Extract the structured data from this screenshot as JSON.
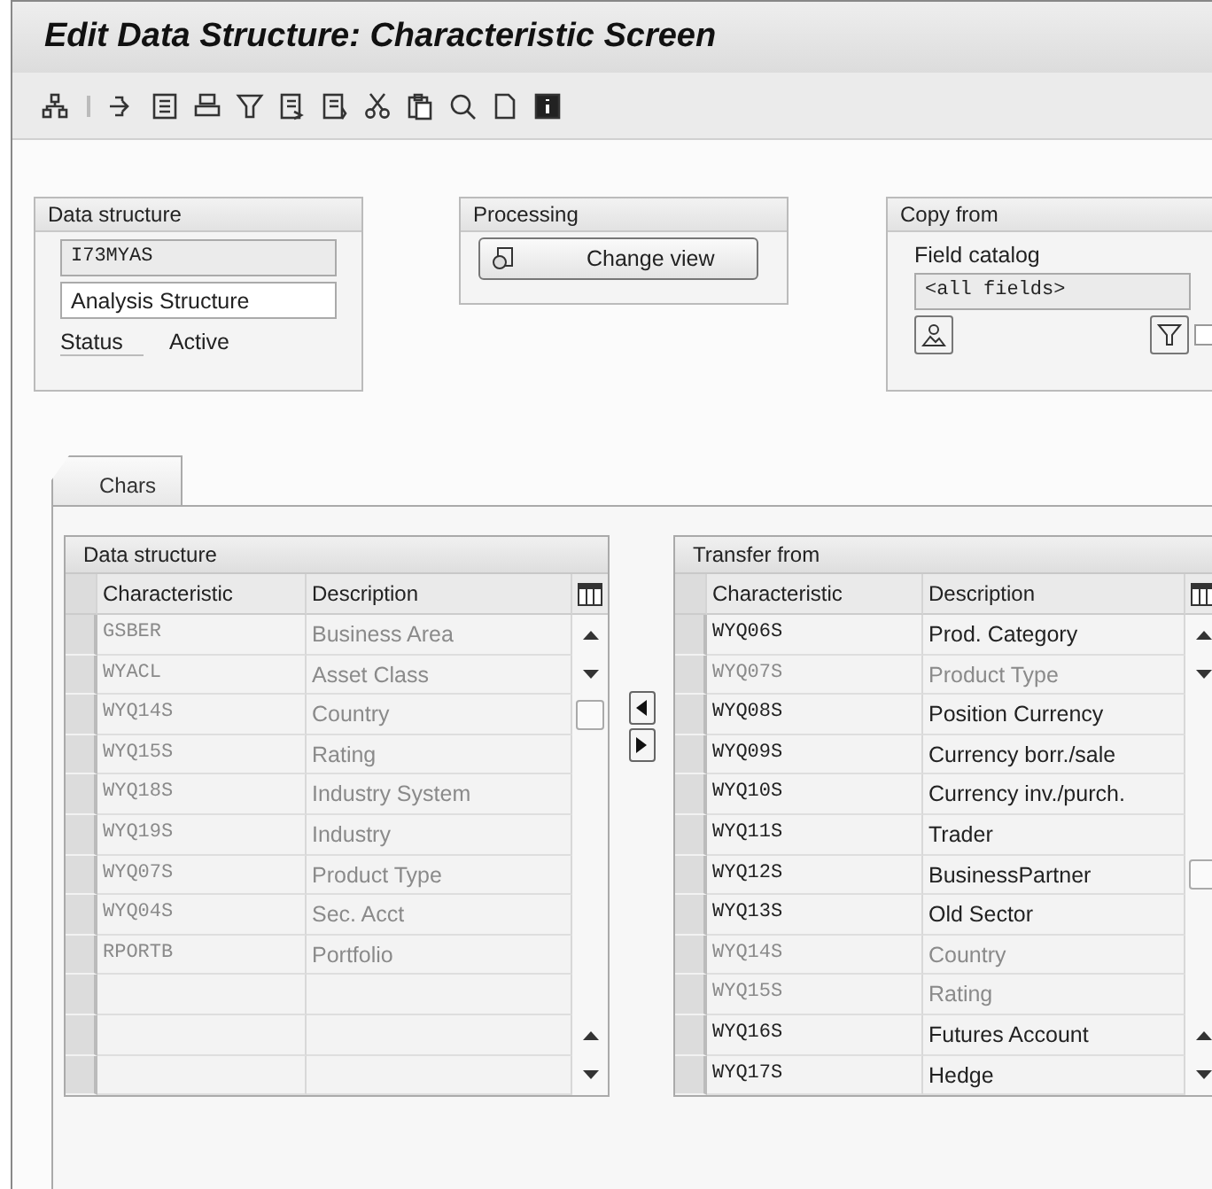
{
  "window": {
    "title": "Edit Data Structure: Characteristic Screen"
  },
  "data_structure": {
    "title": "Data structure",
    "code": "I73MYAS",
    "name": "Analysis Structure",
    "status_label": "Status",
    "status_value": "Active"
  },
  "processing": {
    "title": "Processing",
    "button": "Change view"
  },
  "copy_from": {
    "title": "Copy from",
    "field_label": "Field catalog",
    "field_value": "<all fields>",
    "checked": false
  },
  "tabs": [
    {
      "label": "Chars",
      "selected": true
    }
  ],
  "left_table": {
    "title": "Data structure",
    "columns": [
      "Characteristic",
      "Description"
    ],
    "rows": [
      {
        "char": "GSBER",
        "desc": "Business Area"
      },
      {
        "char": "WYACL",
        "desc": "Asset Class"
      },
      {
        "char": "WYQ14S",
        "desc": "Country"
      },
      {
        "char": "WYQ15S",
        "desc": "Rating"
      },
      {
        "char": "WYQ18S",
        "desc": "Industry System"
      },
      {
        "char": "WYQ19S",
        "desc": "Industry"
      },
      {
        "char": "WYQ07S",
        "desc": "Product Type"
      },
      {
        "char": "WYQ04S",
        "desc": "Sec. Acct"
      },
      {
        "char": "RPORTB",
        "desc": "Portfolio"
      }
    ]
  },
  "right_table": {
    "title": "Transfer from",
    "columns": [
      "Characteristic",
      "Description"
    ],
    "rows": [
      {
        "char": "WYQ06S",
        "desc": "Prod. Category",
        "disabled": false
      },
      {
        "char": "WYQ07S",
        "desc": "Product Type",
        "disabled": true
      },
      {
        "char": "WYQ08S",
        "desc": "Position Currency",
        "disabled": false
      },
      {
        "char": "WYQ09S",
        "desc": "Currency borr./sale",
        "disabled": false
      },
      {
        "char": "WYQ10S",
        "desc": "Currency inv./purch.",
        "disabled": false
      },
      {
        "char": "WYQ11S",
        "desc": "Trader",
        "disabled": false
      },
      {
        "char": "WYQ12S",
        "desc": "BusinessPartner",
        "disabled": false
      },
      {
        "char": "WYQ13S",
        "desc": "Old Sector",
        "disabled": false
      },
      {
        "char": "WYQ14S",
        "desc": "Country",
        "disabled": true
      },
      {
        "char": "WYQ15S",
        "desc": "Rating",
        "disabled": true
      },
      {
        "char": "WYQ16S",
        "desc": "Futures Account",
        "disabled": false
      },
      {
        "char": "WYQ17S",
        "desc": "Hedge",
        "disabled": false
      }
    ]
  }
}
